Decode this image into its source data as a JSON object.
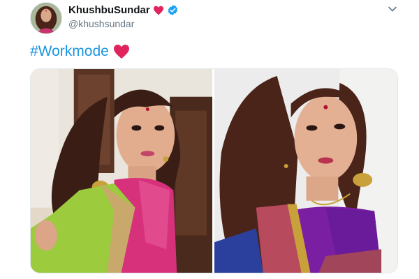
{
  "user": {
    "display_name": "KhushbuSundar",
    "handle": "@khushsundar",
    "avatar_icon": "profile-photo",
    "verified_icon": "verified-badge-icon",
    "name_emoji_icon": "red-heart-icon"
  },
  "tweet": {
    "hashtag": "#Workmode",
    "emoji_icon": "red-heart-icon",
    "menu_icon": "chevron-down-icon"
  },
  "media": {
    "count": 2,
    "photos": [
      {
        "name": "selfie-green-pink-saree"
      },
      {
        "name": "selfie-purple-saree"
      }
    ]
  },
  "colors": {
    "link": "#1b95e0",
    "heart": "#e0245e",
    "verified": "#1da1f2",
    "text": "#14171a",
    "secondary_text": "#657786",
    "border": "#e1e8ed"
  }
}
